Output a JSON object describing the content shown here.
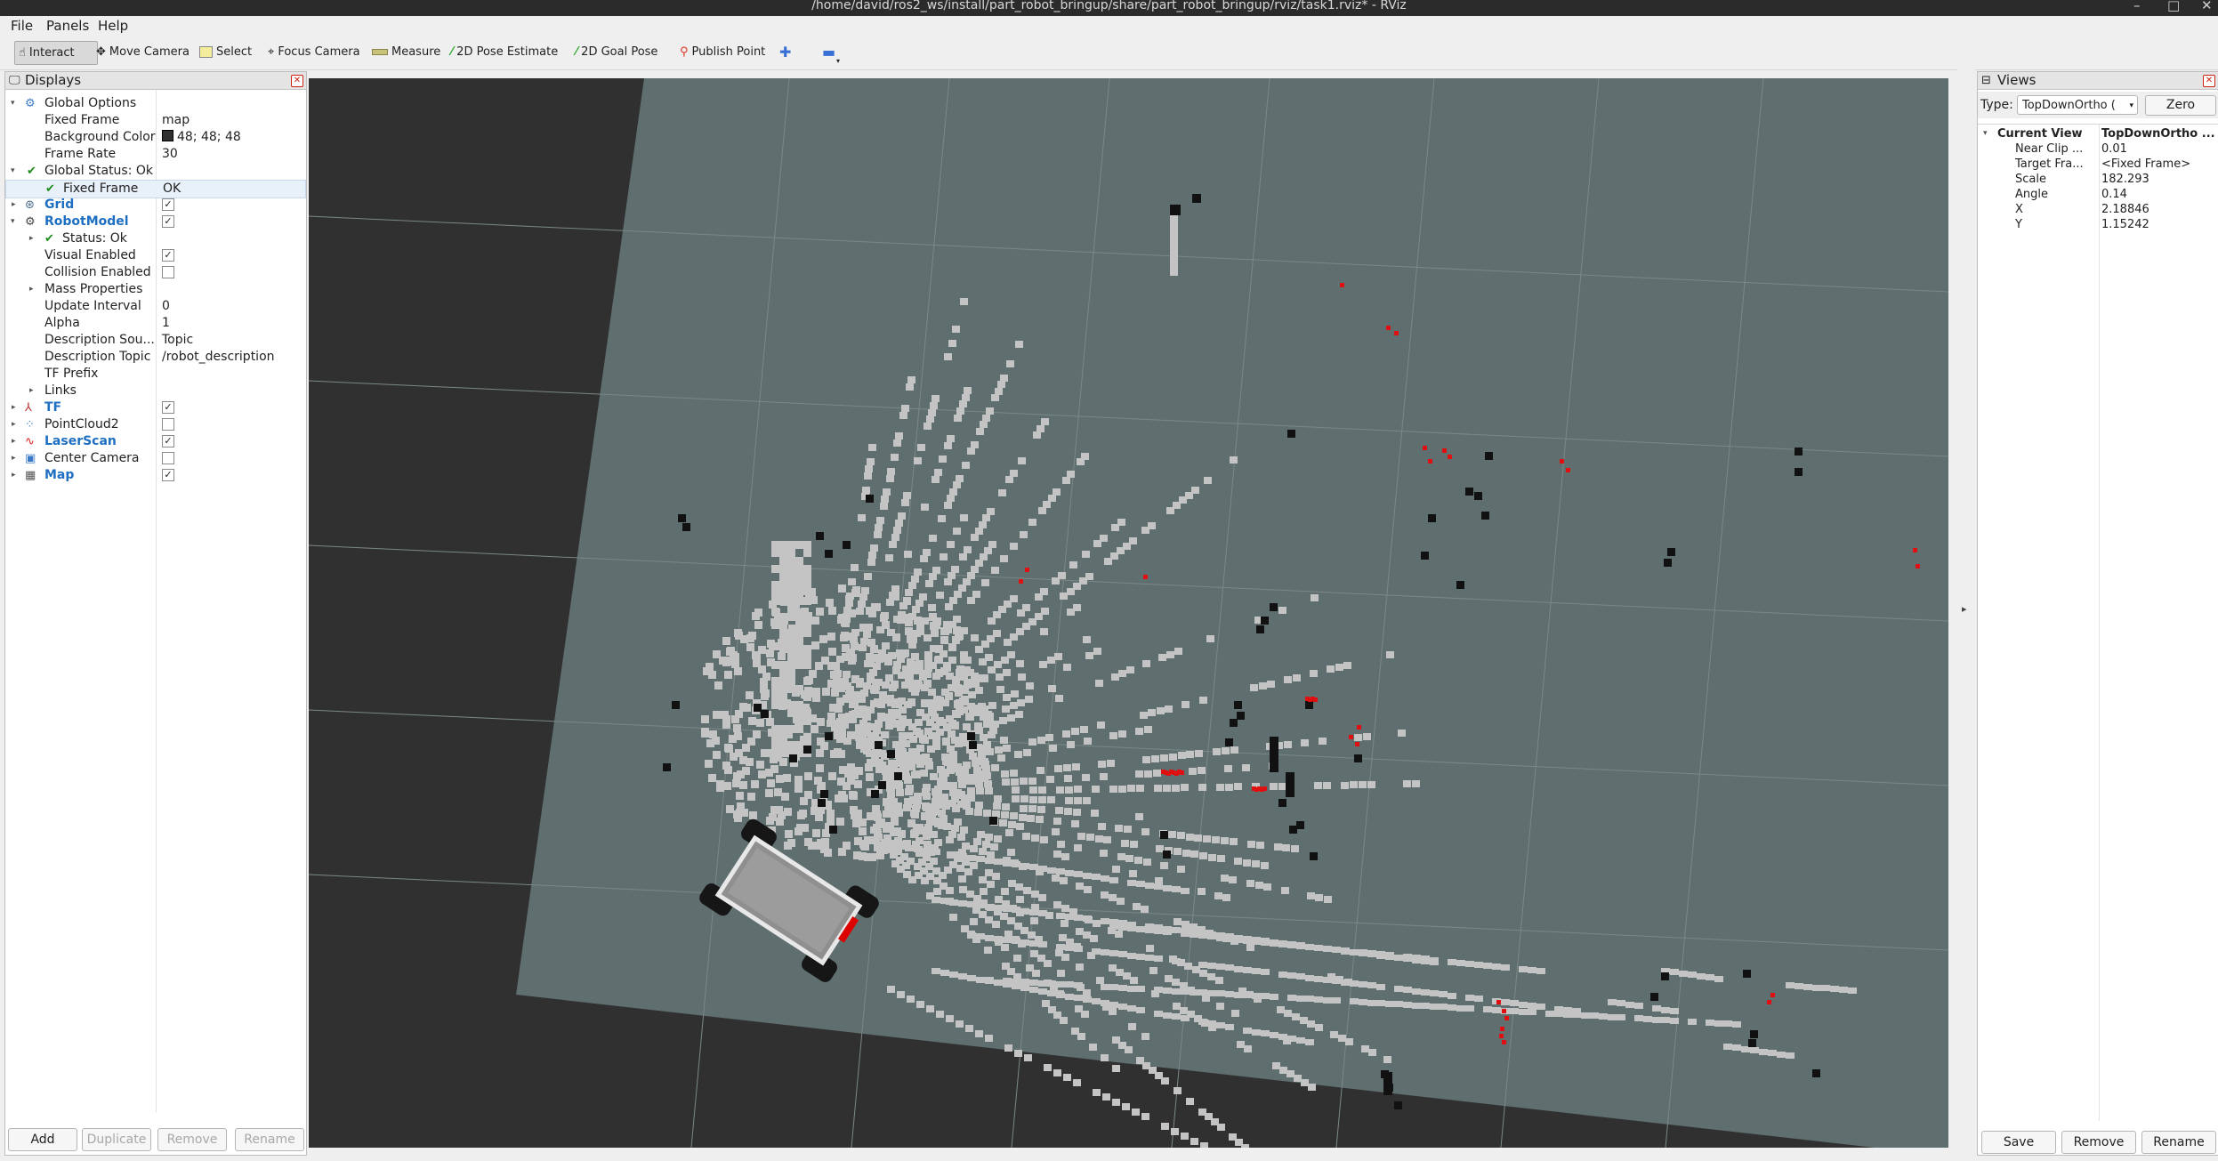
{
  "window": {
    "title": "/home/david/ros2_ws/install/part_robot_bringup/share/part_robot_bringup/rviz/task1.rviz* - RViz"
  },
  "menu": {
    "file": "File",
    "panels": "Panels",
    "help": "Help"
  },
  "toolbar": {
    "interact": "Interact",
    "move_camera": "Move Camera",
    "select": "Select",
    "focus_camera": "Focus Camera",
    "measure": "Measure",
    "pose_estimate": "2D Pose Estimate",
    "goal_pose": "2D Goal Pose",
    "publish_point": "Publish Point"
  },
  "displays": {
    "title": "Displays",
    "global_options": "Global Options",
    "fixed_frame_label": "Fixed Frame",
    "fixed_frame_value": "map",
    "background_color_label": "Background Color",
    "background_color_value": "48; 48; 48",
    "background_color_hex": "#303030",
    "frame_rate_label": "Frame Rate",
    "frame_rate_value": "30",
    "global_status": "Global Status: Ok",
    "status_fixed_frame_label": "Fixed Frame",
    "status_fixed_frame_value": "OK",
    "grid": "Grid",
    "robot_model": "RobotModel",
    "robot_status": "Status: Ok",
    "visual_enabled": "Visual Enabled",
    "collision_enabled": "Collision Enabled",
    "mass_properties": "Mass Properties",
    "update_interval_label": "Update Interval",
    "update_interval_value": "0",
    "alpha_label": "Alpha",
    "alpha_value": "1",
    "description_source_label": "Description Sou...",
    "description_source_value": "Topic",
    "description_topic_label": "Description Topic",
    "description_topic_value": "/robot_description",
    "tf_prefix_label": "TF Prefix",
    "links": "Links",
    "tf": "TF",
    "pointcloud2": "PointCloud2",
    "laserscan": "LaserScan",
    "center_camera": "Center Camera",
    "map": "Map",
    "checks": {
      "grid": true,
      "robot_model": true,
      "visual_enabled": true,
      "collision_enabled": false,
      "tf": true,
      "pointcloud2": false,
      "laserscan": true,
      "center_camera": false,
      "map": true
    },
    "buttons": {
      "add": "Add",
      "duplicate": "Duplicate",
      "remove": "Remove",
      "rename": "Rename"
    }
  },
  "views": {
    "title": "Views",
    "type_label": "Type:",
    "type_value": "TopDownOrtho (",
    "zero": "Zero",
    "current_view_label": "Current View",
    "current_view_value": "TopDownOrtho ...",
    "near_clip_label": "Near Clip ...",
    "near_clip_value": "0.01",
    "target_frame_label": "Target Fra...",
    "target_frame_value": "<Fixed Frame>",
    "scale_label": "Scale",
    "scale_value": "182.293",
    "angle_label": "Angle",
    "angle_value": "0.14",
    "x_label": "X",
    "x_value": "2.18846",
    "y_label": "Y",
    "y_value": "1.15242",
    "buttons": {
      "save": "Save",
      "remove": "Remove",
      "rename": "Rename"
    }
  },
  "colors": {
    "map_unknown": "#5f6e6e",
    "map_free": "#c4c4c4",
    "map_occupied": "#111111",
    "laser": "#e01010",
    "accent": "#1e6fc2"
  }
}
